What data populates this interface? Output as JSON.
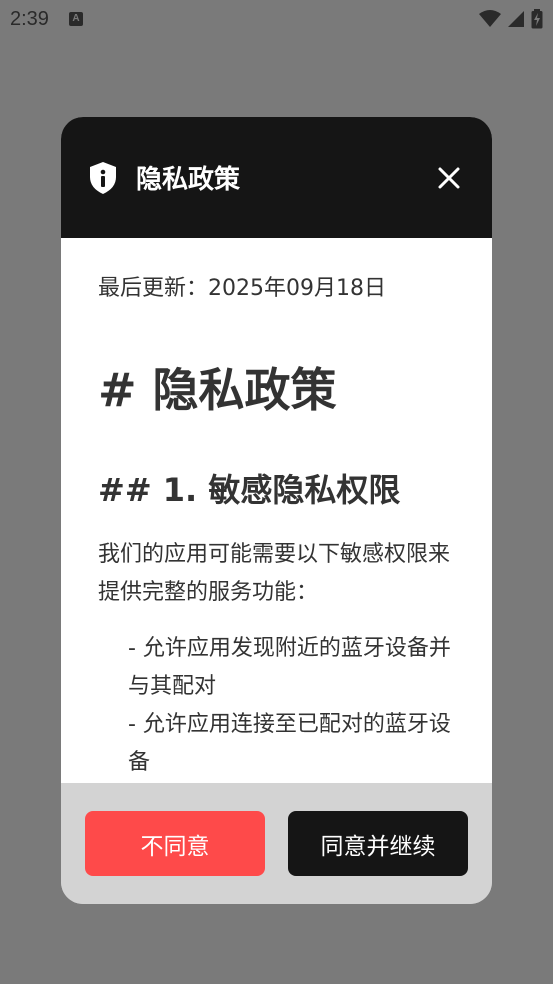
{
  "status_bar": {
    "time": "2:39",
    "a_icon_glyph": "A"
  },
  "dialog": {
    "title": "隐私政策",
    "updated_label": "最后更新：2025年09月18日",
    "heading1": "# 隐私政策",
    "heading2": "## 1. 敏感隐私权限",
    "paragraph": "我们的应用可能需要以下敏感权限来提供完整的服务功能：",
    "list": [
      "- 允许应用发现附近的蓝牙设备并与其配对",
      "- 允许应用连接至已配对的蓝牙设备"
    ],
    "disagree_label": "不同意",
    "agree_label": "同意并继续"
  },
  "colors": {
    "scrim": "#7a7a7a",
    "header": "#151515",
    "disagree": "#fe4a4a",
    "agree": "#151515",
    "footer": "#d3d3d3"
  },
  "icons": {
    "header": "shield-info-icon",
    "close": "close-icon"
  }
}
